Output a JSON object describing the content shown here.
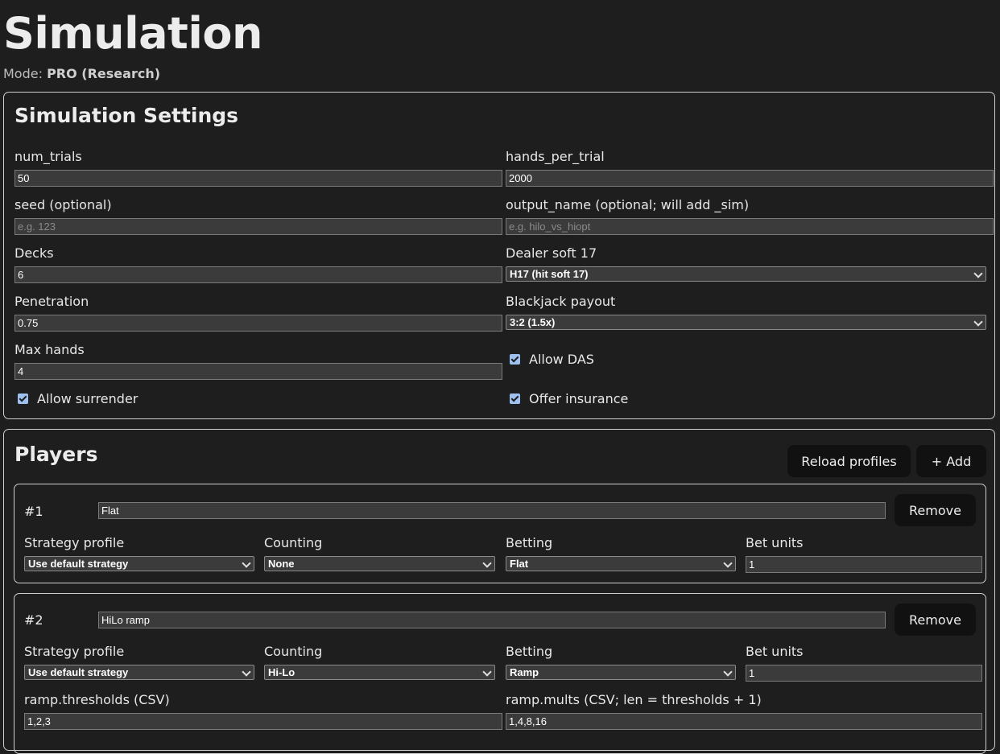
{
  "page": {
    "title": "Simulation",
    "mode_label": "Mode:",
    "mode_value": "PRO (Research)"
  },
  "settings": {
    "title": "Simulation Settings",
    "num_trials": {
      "label": "num_trials",
      "value": "50"
    },
    "hands_per_trial": {
      "label": "hands_per_trial",
      "value": "2000"
    },
    "seed": {
      "label": "seed (optional)",
      "value": "",
      "placeholder": "e.g. 123"
    },
    "output_name": {
      "label": "output_name (optional; will add _sim)",
      "value": "",
      "placeholder": "e.g. hilo_vs_hiopt"
    },
    "decks": {
      "label": "Decks",
      "value": "6"
    },
    "dealer_soft17": {
      "label": "Dealer soft 17",
      "value": "H17 (hit soft 17)"
    },
    "penetration": {
      "label": "Penetration",
      "value": "0.75"
    },
    "bj_payout": {
      "label": "Blackjack payout",
      "value": "3:2 (1.5x)"
    },
    "max_hands": {
      "label": "Max hands",
      "value": "4"
    },
    "allow_das": {
      "label": "Allow DAS",
      "checked": true
    },
    "allow_surrender": {
      "label": "Allow surrender",
      "checked": true
    },
    "offer_insurance": {
      "label": "Offer insurance",
      "checked": true
    }
  },
  "players": {
    "title": "Players",
    "reload_label": "Reload profiles",
    "add_label": "+ Add",
    "remove_label": "Remove",
    "field_labels": {
      "strategy": "Strategy profile",
      "counting": "Counting",
      "betting": "Betting",
      "bet_units": "Bet units",
      "ramp_thresholds": "ramp.thresholds (CSV)",
      "ramp_mults": "ramp.mults (CSV; len = thresholds + 1)"
    },
    "list": [
      {
        "num": "#1",
        "name": "Flat",
        "strategy": "Use default strategy",
        "counting": "None",
        "betting": "Flat",
        "bet_units": "1"
      },
      {
        "num": "#2",
        "name": "HiLo ramp",
        "strategy": "Use default strategy",
        "counting": "Hi-Lo",
        "betting": "Ramp",
        "bet_units": "1",
        "ramp_thresholds": "1,2,3",
        "ramp_mults": "1,4,8,16"
      }
    ]
  }
}
